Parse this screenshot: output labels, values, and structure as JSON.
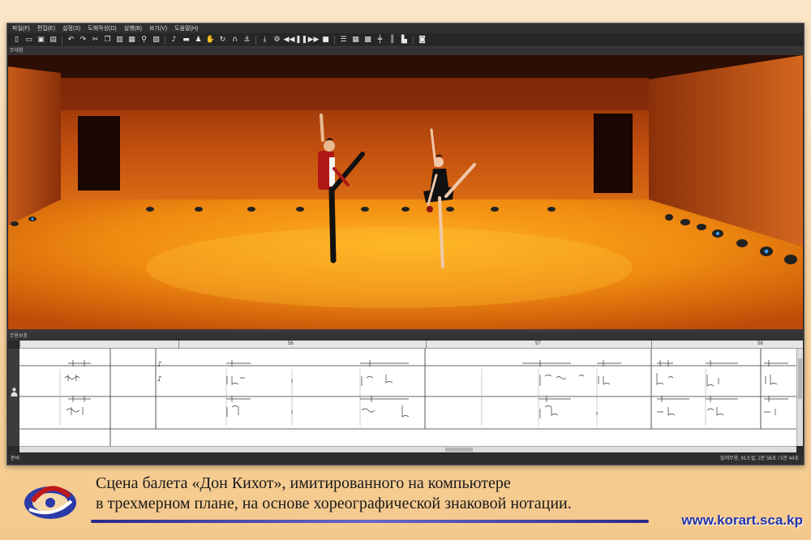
{
  "menubar": {
    "items": [
      "파일(F)",
      "편집(E)",
      "설정(S)",
      "도해작성(D)",
      "실행(B)",
      "보기(V)",
      "도움말(H)"
    ]
  },
  "toolbar": {
    "buttons": [
      {
        "icon": "new-file-icon",
        "glyph": "▯"
      },
      {
        "icon": "open-folder-icon",
        "glyph": "▭"
      },
      {
        "icon": "save-icon",
        "glyph": "▣"
      },
      {
        "icon": "save-all-icon",
        "glyph": "▤"
      },
      {
        "sep": true
      },
      {
        "icon": "undo-icon",
        "glyph": "↶"
      },
      {
        "icon": "redo-icon",
        "glyph": "↷"
      },
      {
        "icon": "cut-icon",
        "glyph": "✂"
      },
      {
        "icon": "copy-icon",
        "glyph": "❐"
      },
      {
        "icon": "paste-icon",
        "glyph": "▥"
      },
      {
        "icon": "clipboard-icon",
        "glyph": "▦"
      },
      {
        "icon": "find-icon",
        "glyph": "⚲"
      },
      {
        "icon": "image-icon",
        "glyph": "▨"
      },
      {
        "sep": true
      },
      {
        "icon": "notation-icon",
        "glyph": "♪"
      },
      {
        "icon": "ruler-icon",
        "glyph": "▬"
      },
      {
        "icon": "figure-icon",
        "glyph": "♟"
      },
      {
        "icon": "hand-icon",
        "glyph": "✋"
      },
      {
        "icon": "rotate-icon",
        "glyph": "↻"
      },
      {
        "icon": "headphone-icon",
        "glyph": "∩"
      },
      {
        "icon": "anchor-icon",
        "glyph": "⚓"
      },
      {
        "sep": true
      },
      {
        "icon": "download-icon",
        "glyph": "⤓"
      },
      {
        "icon": "gear-icon",
        "glyph": "⚙"
      },
      {
        "icon": "rewind-icon",
        "glyph": "◀◀"
      },
      {
        "icon": "pause-icon",
        "glyph": "❚❚"
      },
      {
        "icon": "fast-forward-icon",
        "glyph": "▶▶"
      },
      {
        "icon": "stop-icon",
        "glyph": "■"
      },
      {
        "sep": true
      },
      {
        "icon": "list-icon",
        "glyph": "☰"
      },
      {
        "icon": "grid-icon",
        "glyph": "▦"
      },
      {
        "icon": "keyboard-icon",
        "glyph": "▩"
      },
      {
        "icon": "align-icon",
        "glyph": "╪"
      },
      {
        "icon": "columns-icon",
        "glyph": "║"
      },
      {
        "icon": "chart-icon",
        "glyph": "▙"
      },
      {
        "sep": true
      },
      {
        "icon": "camera-icon",
        "glyph": "◙"
      }
    ]
  },
  "panels": {
    "stage_label": "무대창",
    "notation_label": "무용보창"
  },
  "ruler": {
    "measures": [
      {
        "num": "56"
      },
      {
        "num": "57"
      },
      {
        "num": "58"
      }
    ]
  },
  "status": {
    "left": "준비",
    "right": "발레무용, 91소절, 2분 56초 / 5분 44초"
  },
  "caption": {
    "line1": "Сцена балета «Дон Кихот», имитированного на компьютере",
    "line2": "в трехмерном плане, на основе хореографической знаковой нотации."
  },
  "site_url": "www.korart.sca.kp",
  "colors": {
    "stage_floor": "#e07a12",
    "stage_wall": "#b8430e",
    "caption_bar": "#2a2a8a",
    "url": "#2233aa"
  }
}
